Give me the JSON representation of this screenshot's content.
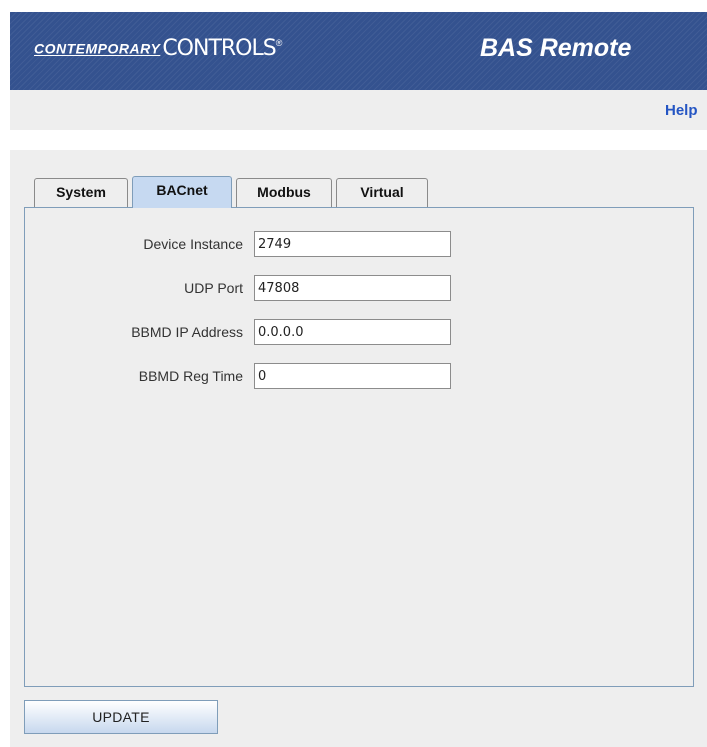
{
  "header": {
    "logo_part1": "CONTEMPORARY",
    "logo_part2": "CONTROLS",
    "logo_reg": "®",
    "product_title": "BAS Remote",
    "colors": {
      "banner": "#34528f",
      "text": "#ffffff"
    }
  },
  "help": {
    "label": "Help"
  },
  "tabs": [
    {
      "label": "System",
      "active": false
    },
    {
      "label": "BACnet",
      "active": true
    },
    {
      "label": "Modbus",
      "active": false
    },
    {
      "label": "Virtual",
      "active": false
    }
  ],
  "form": {
    "fields": [
      {
        "label": "Device Instance",
        "value": "2749"
      },
      {
        "label": "UDP Port",
        "value": "47808"
      },
      {
        "label": "BBMD IP Address",
        "value": "0.0.0.0"
      },
      {
        "label": "BBMD Reg Time",
        "value": "0"
      }
    ]
  },
  "update_button": {
    "label": "UPDATE"
  },
  "colors": {
    "accent": "#c6d9f1",
    "panel_border": "#7f9db9",
    "help_link": "#2455c3",
    "page_bg": "#eeeeee"
  }
}
